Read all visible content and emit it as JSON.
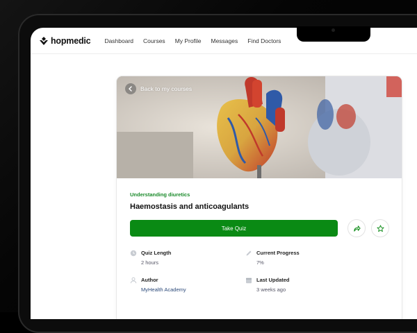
{
  "nav": {
    "brand": "hopmedic",
    "links": [
      "Dashboard",
      "Courses",
      "My Profile",
      "Messages",
      "Find Doctors"
    ]
  },
  "hero": {
    "back_label": "Back to my courses"
  },
  "course": {
    "subtitle": "Understanding diuretics",
    "title": "Haemostasis and anticoagulants",
    "cta": "Take Quiz"
  },
  "meta": {
    "quiz_length": {
      "label": "Quiz Length",
      "value": "2 hours"
    },
    "progress": {
      "label": "Current Progress",
      "value": "7%"
    },
    "author": {
      "label": "Author",
      "value": "MyHealth Academy"
    },
    "updated": {
      "label": "Last Updated",
      "value": "3 weeks ago"
    }
  },
  "colors": {
    "accent": "#0a8a14",
    "accent_text": "#1a8a2a"
  },
  "icons": [
    "back-arrow-icon",
    "share-icon",
    "star-icon",
    "clock-icon",
    "pencil-icon",
    "user-icon",
    "calendar-icon",
    "hopmedic-logo-icon"
  ]
}
